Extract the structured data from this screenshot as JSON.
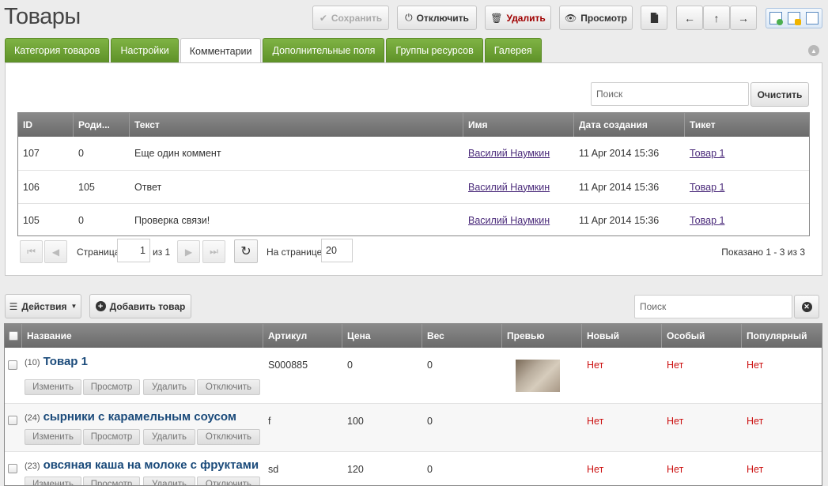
{
  "header": {
    "title": "Товары",
    "buttons": {
      "save": "Сохранить",
      "disable": "Отключить",
      "delete": "Удалить",
      "view": "Просмотр"
    }
  },
  "tabs": [
    {
      "label": "Категория товаров"
    },
    {
      "label": "Настройки"
    },
    {
      "label": "Комментарии",
      "active": true
    },
    {
      "label": "Дополнительные поля"
    },
    {
      "label": "Группы ресурсов"
    },
    {
      "label": "Галерея"
    }
  ],
  "comments": {
    "search_placeholder": "Поиск",
    "clear_label": "Очистить",
    "columns": [
      "ID",
      "Роди...",
      "Текст",
      "Имя",
      "Дата создания",
      "Тикет"
    ],
    "rows": [
      {
        "id": "107",
        "parent": "0",
        "text": "Еще один коммент",
        "name": "Василий Наумкин",
        "date": "11 Apr 2014 15:36",
        "ticket": "Товар 1"
      },
      {
        "id": "106",
        "parent": "105",
        "text": "Ответ",
        "name": "Василий Наумкин",
        "date": "11 Apr 2014 15:36",
        "ticket": "Товар 1"
      },
      {
        "id": "105",
        "parent": "0",
        "text": "Проверка связи!",
        "name": "Василий Наумкин",
        "date": "11 Apr 2014 15:36",
        "ticket": "Товар 1"
      }
    ],
    "pager": {
      "page_label": "Страница",
      "page_value": "1",
      "of_label": "из 1",
      "per_page_label": "На странице:",
      "per_page_value": "20",
      "shown": "Показано 1 - 3 из 3"
    }
  },
  "products": {
    "actions_label": "Действия",
    "add_label": "Добавить товар",
    "search_placeholder": "Поиск",
    "columns": [
      "Название",
      "Артикул",
      "Цена",
      "Вес",
      "Превью",
      "Новый",
      "Особый",
      "Популярный"
    ],
    "row_buttons": [
      "Изменить",
      "Просмотр",
      "Удалить",
      "Отключить"
    ],
    "rows": [
      {
        "count": "(10)",
        "name": "Товар 1",
        "article": "S000885",
        "price": "0",
        "weight": "0",
        "has_preview": true,
        "new": "Нет",
        "special": "Нет",
        "popular": "Нет"
      },
      {
        "count": "(24)",
        "name": "сырники с карамельным соусом",
        "article": "f",
        "price": "100",
        "weight": "0",
        "has_preview": false,
        "new": "Нет",
        "special": "Нет",
        "popular": "Нет"
      },
      {
        "count": "(23)",
        "name": "овсяная каша на молоке с фруктами",
        "article": "sd",
        "price": "120",
        "weight": "0",
        "has_preview": false,
        "new": "Нет",
        "special": "Нет",
        "popular": "Нет"
      }
    ]
  },
  "colors": {
    "tab_green": "#6ea536",
    "grid_header": "#777777",
    "no_red": "#cc1111",
    "link_purple": "#4a2a7a",
    "product_name": "#1a4a7a"
  }
}
